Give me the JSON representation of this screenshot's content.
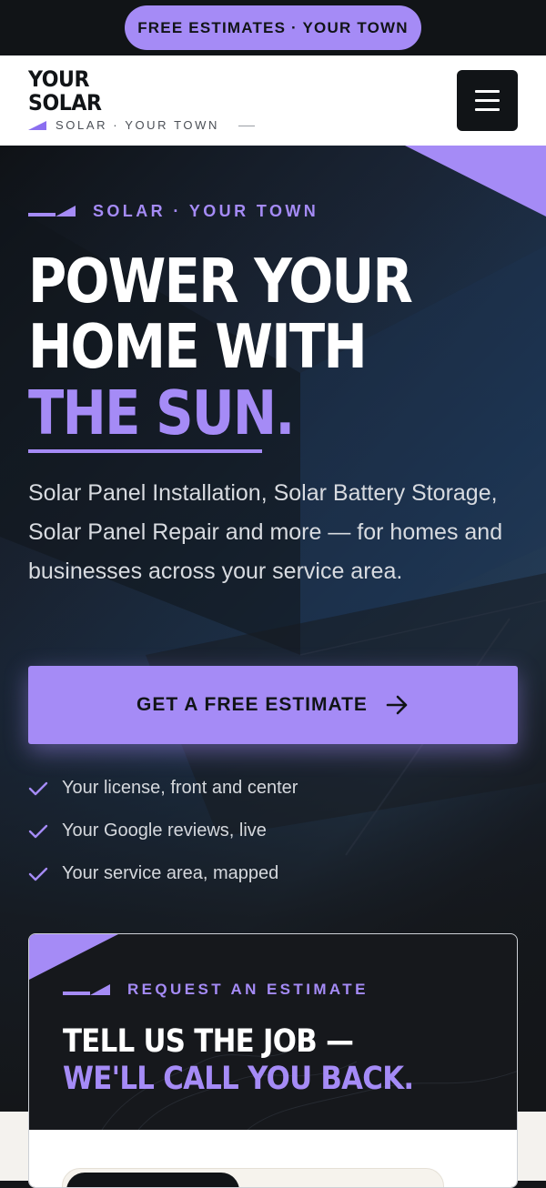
{
  "announcement": {
    "label": "FREE ESTIMATES · YOUR TOWN"
  },
  "header": {
    "logo_line1": "YOUR",
    "logo_line2": "SOLAR",
    "tagline": "SOLAR · YOUR TOWN",
    "menu_icon": "hamburger-menu-icon"
  },
  "hero": {
    "eyebrow": "SOLAR · YOUR TOWN",
    "title_line1": "POWER YOUR",
    "title_line2": "HOME WITH",
    "title_accent": "THE SUN.",
    "lead": "Solar Panel Installation, Solar Battery Storage, Solar Panel Repair and more — for homes and businesses across your service area.",
    "cta_label": "GET A FREE ESTIMATE",
    "cta_icon": "arrow-right-icon",
    "checks": [
      "Your license, front and center",
      "Your Google reviews, live",
      "Your service area, mapped"
    ]
  },
  "estimate_card": {
    "eyebrow": "REQUEST AN ESTIMATE",
    "title_line1": "TELL US THE JOB —",
    "title_line2": "WE'LL CALL YOU BACK."
  },
  "colors": {
    "accent": "#a58bf6",
    "dark": "#111417",
    "white": "#ffffff"
  }
}
